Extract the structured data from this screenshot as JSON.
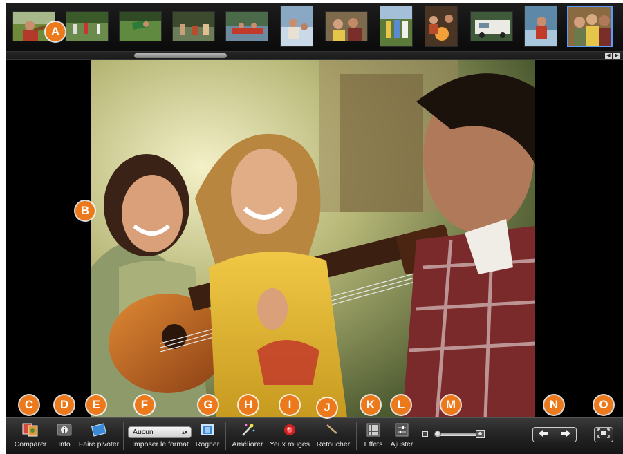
{
  "filmstrip": {
    "thumbnails": [
      "photo-1",
      "photo-2",
      "photo-3",
      "photo-4",
      "photo-5",
      "photo-6",
      "photo-7",
      "photo-8",
      "photo-9",
      "photo-10",
      "photo-11",
      "photo-12"
    ],
    "selected_index": 11,
    "scroll_left_arrow": "◀",
    "scroll_right_arrow": "▶"
  },
  "callouts": {
    "a": "A",
    "b": "B",
    "c": "C",
    "d": "D",
    "e": "E",
    "f": "F",
    "g": "G",
    "h": "H",
    "i": "I",
    "j": "J",
    "k": "K",
    "l": "L",
    "m": "M",
    "n": "N",
    "o": "O"
  },
  "toolbar": {
    "compare_label": "Comparer",
    "info_label": "Info",
    "rotate_label": "Faire pivoter",
    "format_label": "Imposer le format",
    "format_value": "Aucun",
    "crop_label": "Rogner",
    "enhance_label": "Améliorer",
    "redeye_label": "Yeux rouges",
    "retouch_label": "Retoucher",
    "effects_label": "Effets",
    "adjust_label": "Ajuster",
    "zoom_level": 0.0
  },
  "icons": {
    "compare": "compare-icon",
    "info": "info-icon",
    "rotate": "rotate-icon",
    "crop": "crop-icon",
    "enhance": "magic-wand-icon",
    "redeye": "red-eye-icon",
    "retouch": "brush-icon",
    "effects": "effects-grid-icon",
    "adjust": "sliders-icon",
    "previous": "arrow-left-icon",
    "next": "arrow-right-icon",
    "fullscreen": "fullscreen-icon"
  },
  "colors": {
    "callout": "#ec7a1c",
    "selection": "#5a9bff",
    "toolbar_text": "#e6e6e6"
  }
}
